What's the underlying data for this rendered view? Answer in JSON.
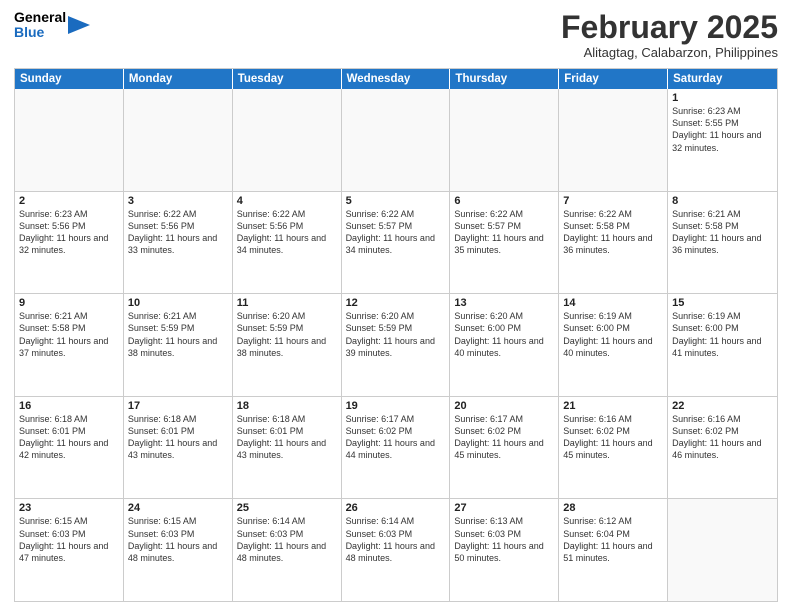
{
  "header": {
    "logo_general": "General",
    "logo_blue": "Blue",
    "month_title": "February 2025",
    "location": "Alitagtag, Calabarzon, Philippines"
  },
  "calendar": {
    "days_of_week": [
      "Sunday",
      "Monday",
      "Tuesday",
      "Wednesday",
      "Thursday",
      "Friday",
      "Saturday"
    ],
    "weeks": [
      [
        {
          "day": "",
          "info": ""
        },
        {
          "day": "",
          "info": ""
        },
        {
          "day": "",
          "info": ""
        },
        {
          "day": "",
          "info": ""
        },
        {
          "day": "",
          "info": ""
        },
        {
          "day": "",
          "info": ""
        },
        {
          "day": "1",
          "info": "Sunrise: 6:23 AM\nSunset: 5:55 PM\nDaylight: 11 hours and 32 minutes."
        }
      ],
      [
        {
          "day": "2",
          "info": "Sunrise: 6:23 AM\nSunset: 5:56 PM\nDaylight: 11 hours and 32 minutes."
        },
        {
          "day": "3",
          "info": "Sunrise: 6:22 AM\nSunset: 5:56 PM\nDaylight: 11 hours and 33 minutes."
        },
        {
          "day": "4",
          "info": "Sunrise: 6:22 AM\nSunset: 5:56 PM\nDaylight: 11 hours and 34 minutes."
        },
        {
          "day": "5",
          "info": "Sunrise: 6:22 AM\nSunset: 5:57 PM\nDaylight: 11 hours and 34 minutes."
        },
        {
          "day": "6",
          "info": "Sunrise: 6:22 AM\nSunset: 5:57 PM\nDaylight: 11 hours and 35 minutes."
        },
        {
          "day": "7",
          "info": "Sunrise: 6:22 AM\nSunset: 5:58 PM\nDaylight: 11 hours and 36 minutes."
        },
        {
          "day": "8",
          "info": "Sunrise: 6:21 AM\nSunset: 5:58 PM\nDaylight: 11 hours and 36 minutes."
        }
      ],
      [
        {
          "day": "9",
          "info": "Sunrise: 6:21 AM\nSunset: 5:58 PM\nDaylight: 11 hours and 37 minutes."
        },
        {
          "day": "10",
          "info": "Sunrise: 6:21 AM\nSunset: 5:59 PM\nDaylight: 11 hours and 38 minutes."
        },
        {
          "day": "11",
          "info": "Sunrise: 6:20 AM\nSunset: 5:59 PM\nDaylight: 11 hours and 38 minutes."
        },
        {
          "day": "12",
          "info": "Sunrise: 6:20 AM\nSunset: 5:59 PM\nDaylight: 11 hours and 39 minutes."
        },
        {
          "day": "13",
          "info": "Sunrise: 6:20 AM\nSunset: 6:00 PM\nDaylight: 11 hours and 40 minutes."
        },
        {
          "day": "14",
          "info": "Sunrise: 6:19 AM\nSunset: 6:00 PM\nDaylight: 11 hours and 40 minutes."
        },
        {
          "day": "15",
          "info": "Sunrise: 6:19 AM\nSunset: 6:00 PM\nDaylight: 11 hours and 41 minutes."
        }
      ],
      [
        {
          "day": "16",
          "info": "Sunrise: 6:18 AM\nSunset: 6:01 PM\nDaylight: 11 hours and 42 minutes."
        },
        {
          "day": "17",
          "info": "Sunrise: 6:18 AM\nSunset: 6:01 PM\nDaylight: 11 hours and 43 minutes."
        },
        {
          "day": "18",
          "info": "Sunrise: 6:18 AM\nSunset: 6:01 PM\nDaylight: 11 hours and 43 minutes."
        },
        {
          "day": "19",
          "info": "Sunrise: 6:17 AM\nSunset: 6:02 PM\nDaylight: 11 hours and 44 minutes."
        },
        {
          "day": "20",
          "info": "Sunrise: 6:17 AM\nSunset: 6:02 PM\nDaylight: 11 hours and 45 minutes."
        },
        {
          "day": "21",
          "info": "Sunrise: 6:16 AM\nSunset: 6:02 PM\nDaylight: 11 hours and 45 minutes."
        },
        {
          "day": "22",
          "info": "Sunrise: 6:16 AM\nSunset: 6:02 PM\nDaylight: 11 hours and 46 minutes."
        }
      ],
      [
        {
          "day": "23",
          "info": "Sunrise: 6:15 AM\nSunset: 6:03 PM\nDaylight: 11 hours and 47 minutes."
        },
        {
          "day": "24",
          "info": "Sunrise: 6:15 AM\nSunset: 6:03 PM\nDaylight: 11 hours and 48 minutes."
        },
        {
          "day": "25",
          "info": "Sunrise: 6:14 AM\nSunset: 6:03 PM\nDaylight: 11 hours and 48 minutes."
        },
        {
          "day": "26",
          "info": "Sunrise: 6:14 AM\nSunset: 6:03 PM\nDaylight: 11 hours and 48 minutes."
        },
        {
          "day": "27",
          "info": "Sunrise: 6:13 AM\nSunset: 6:03 PM\nDaylight: 11 hours and 50 minutes."
        },
        {
          "day": "28",
          "info": "Sunrise: 6:12 AM\nSunset: 6:04 PM\nDaylight: 11 hours and 51 minutes."
        },
        {
          "day": "",
          "info": ""
        }
      ]
    ]
  }
}
